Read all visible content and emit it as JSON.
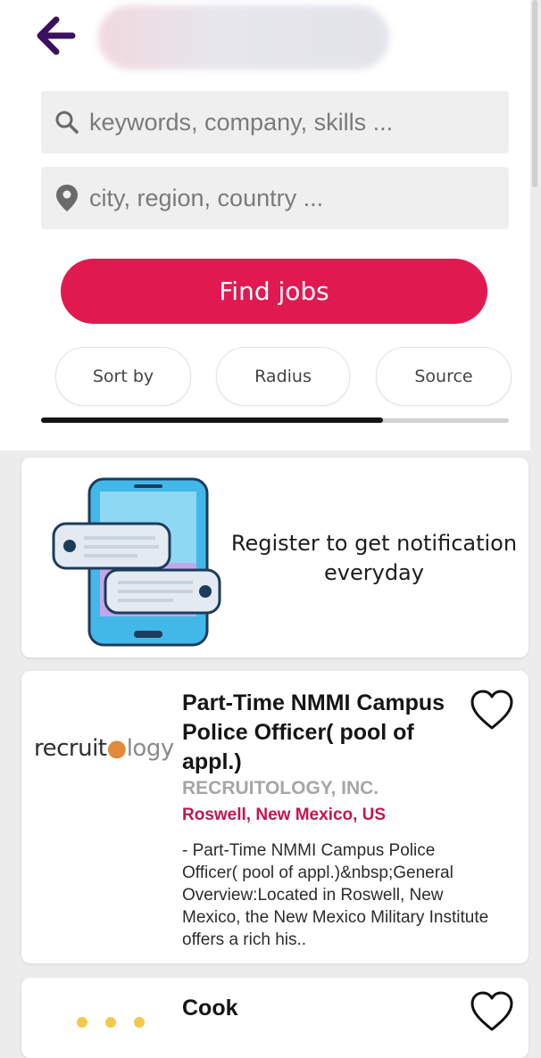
{
  "search": {
    "keywords_placeholder": "keywords, company, skills ...",
    "location_placeholder": "city, region, country ...",
    "find_label": "Find jobs"
  },
  "filters": [
    {
      "label": "Sort by"
    },
    {
      "label": "Radius"
    },
    {
      "label": "Source"
    }
  ],
  "progress": 0.73,
  "promo": {
    "text": "Register to get notification everyday"
  },
  "jobs": [
    {
      "logo_text": "recruitology",
      "title": "Part-Time NMMI Campus Police Officer( pool of appl.)",
      "company": "RECRUITOLOGY, INC.",
      "location": "Roswell, New Mexico, US",
      "description": "- Part-Time NMMI Campus Police Officer( pool of appl.)&nbsp;General Overview:Located in Roswell, New Mexico, the New Mexico Military Institute offers a rich his.."
    },
    {
      "title": "Cook"
    }
  ],
  "colors": {
    "accent": "#e01a51",
    "back_arrow": "#3a1160",
    "location": "#c4164e"
  },
  "icons": [
    "back-arrow-icon",
    "search-icon",
    "location-pin-icon",
    "heart-icon",
    "phone-notification-icon"
  ]
}
